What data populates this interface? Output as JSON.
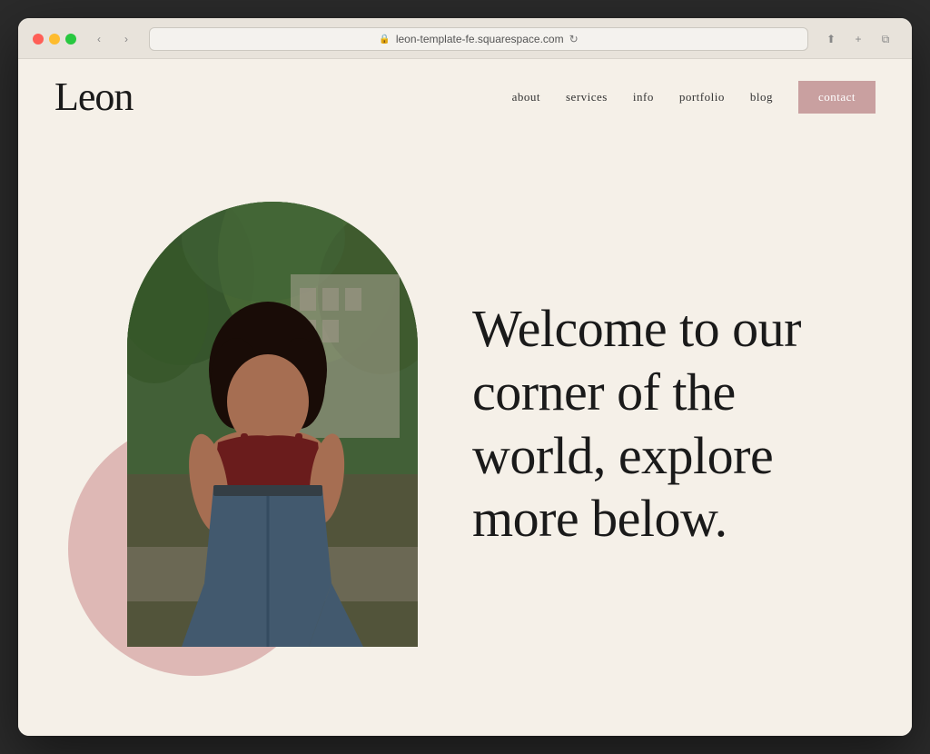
{
  "browser": {
    "url": "leon-template-fe.squarespace.com",
    "lock_icon": "🔒",
    "reload_icon": "↻",
    "back_icon": "‹",
    "forward_icon": "›",
    "share_icon": "⬆",
    "add_tab_icon": "+",
    "tabs_icon": "⧉",
    "window_controls_icon": "⊞"
  },
  "site": {
    "logo": "Leon",
    "nav": {
      "links": [
        {
          "label": "about",
          "id": "about"
        },
        {
          "label": "services",
          "id": "services"
        },
        {
          "label": "info",
          "id": "info"
        },
        {
          "label": "portfolio",
          "id": "portfolio"
        },
        {
          "label": "blog",
          "id": "blog"
        }
      ],
      "contact_label": "contact"
    },
    "hero": {
      "heading_line1": "Welcome to our",
      "heading_line2": "corner of the",
      "heading_line3": "world, explore",
      "heading_line4": "more below."
    }
  },
  "colors": {
    "bg": "#f5f0e8",
    "accent_circle": "#d4a0a0",
    "contact_btn": "#c9a0a0",
    "text_dark": "#1a1a1a",
    "nav_text": "#333333"
  }
}
